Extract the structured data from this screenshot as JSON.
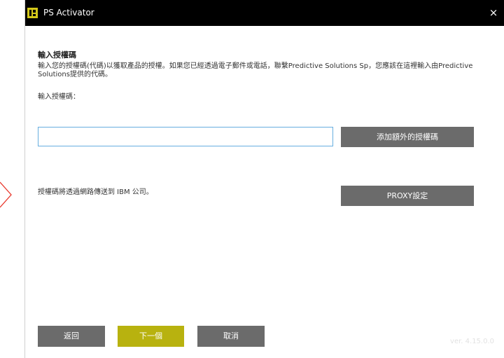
{
  "window": {
    "title": "PS Activator",
    "close_glyph": "×"
  },
  "main": {
    "heading": "輸入授權碼",
    "description": "輸入您的授權碼(代碼)以獲取產品的授權。如果您已經透過電子郵件或電話，聯繫Predictive Solutions Sp，您應該在這裡輸入由Predictive Solutions提供的代碼。",
    "input_label": "輸入授權碼：",
    "code_input_value": "",
    "add_code_button": "添加額外的授權碼",
    "network_note": "授權碼將透過網路傳送到 IBM 公司。",
    "proxy_button": "PROXY設定"
  },
  "footer": {
    "back_button": "返回",
    "next_button": "下一個",
    "cancel_button": "取消",
    "version": "ver. 4.15.0.0"
  },
  "colors": {
    "titlebar": "#000000",
    "gray_button": "#6b6b6b",
    "next_button": "#b8b20f",
    "input_border": "#66aee0",
    "chevron": "#e8372c"
  },
  "icons": {
    "app": "ps-activator-app-icon",
    "close": "close-icon",
    "side": "chevron-right-icon"
  }
}
